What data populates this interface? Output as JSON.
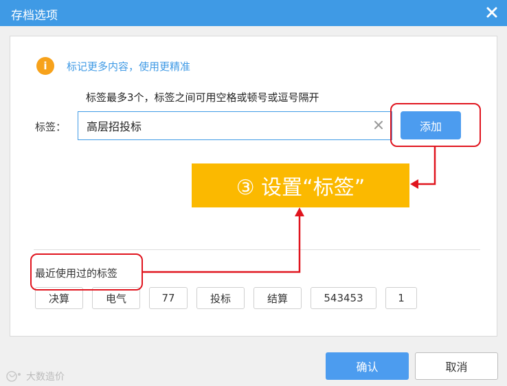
{
  "window": {
    "title": "存档选项"
  },
  "info": {
    "text": "标记更多内容，使用更精准"
  },
  "hint": "标签最多3个，标签之间可用空格或顿号或逗号隔开",
  "tag": {
    "label": "标签：",
    "value": "高层招投标",
    "add_label": "添加"
  },
  "annotation": {
    "text": "③ 设置“标签”"
  },
  "recent": {
    "label": "最近使用过的标签",
    "tags": [
      "决算",
      "电气",
      "77",
      "投标",
      "结算",
      "543453",
      "1"
    ]
  },
  "footer": {
    "ok_label": "确认",
    "cancel_label": "取消"
  },
  "watermark": {
    "text": "大数造价"
  },
  "colors": {
    "titlebar": "#3f9ae5",
    "accent": "#4c9cef",
    "annotation": "#fbb900",
    "highlight": "#e0141e",
    "info_icon": "#f7a21b"
  },
  "icons": {
    "close": "close-icon",
    "info": "info-icon",
    "clear": "clear-icon"
  }
}
